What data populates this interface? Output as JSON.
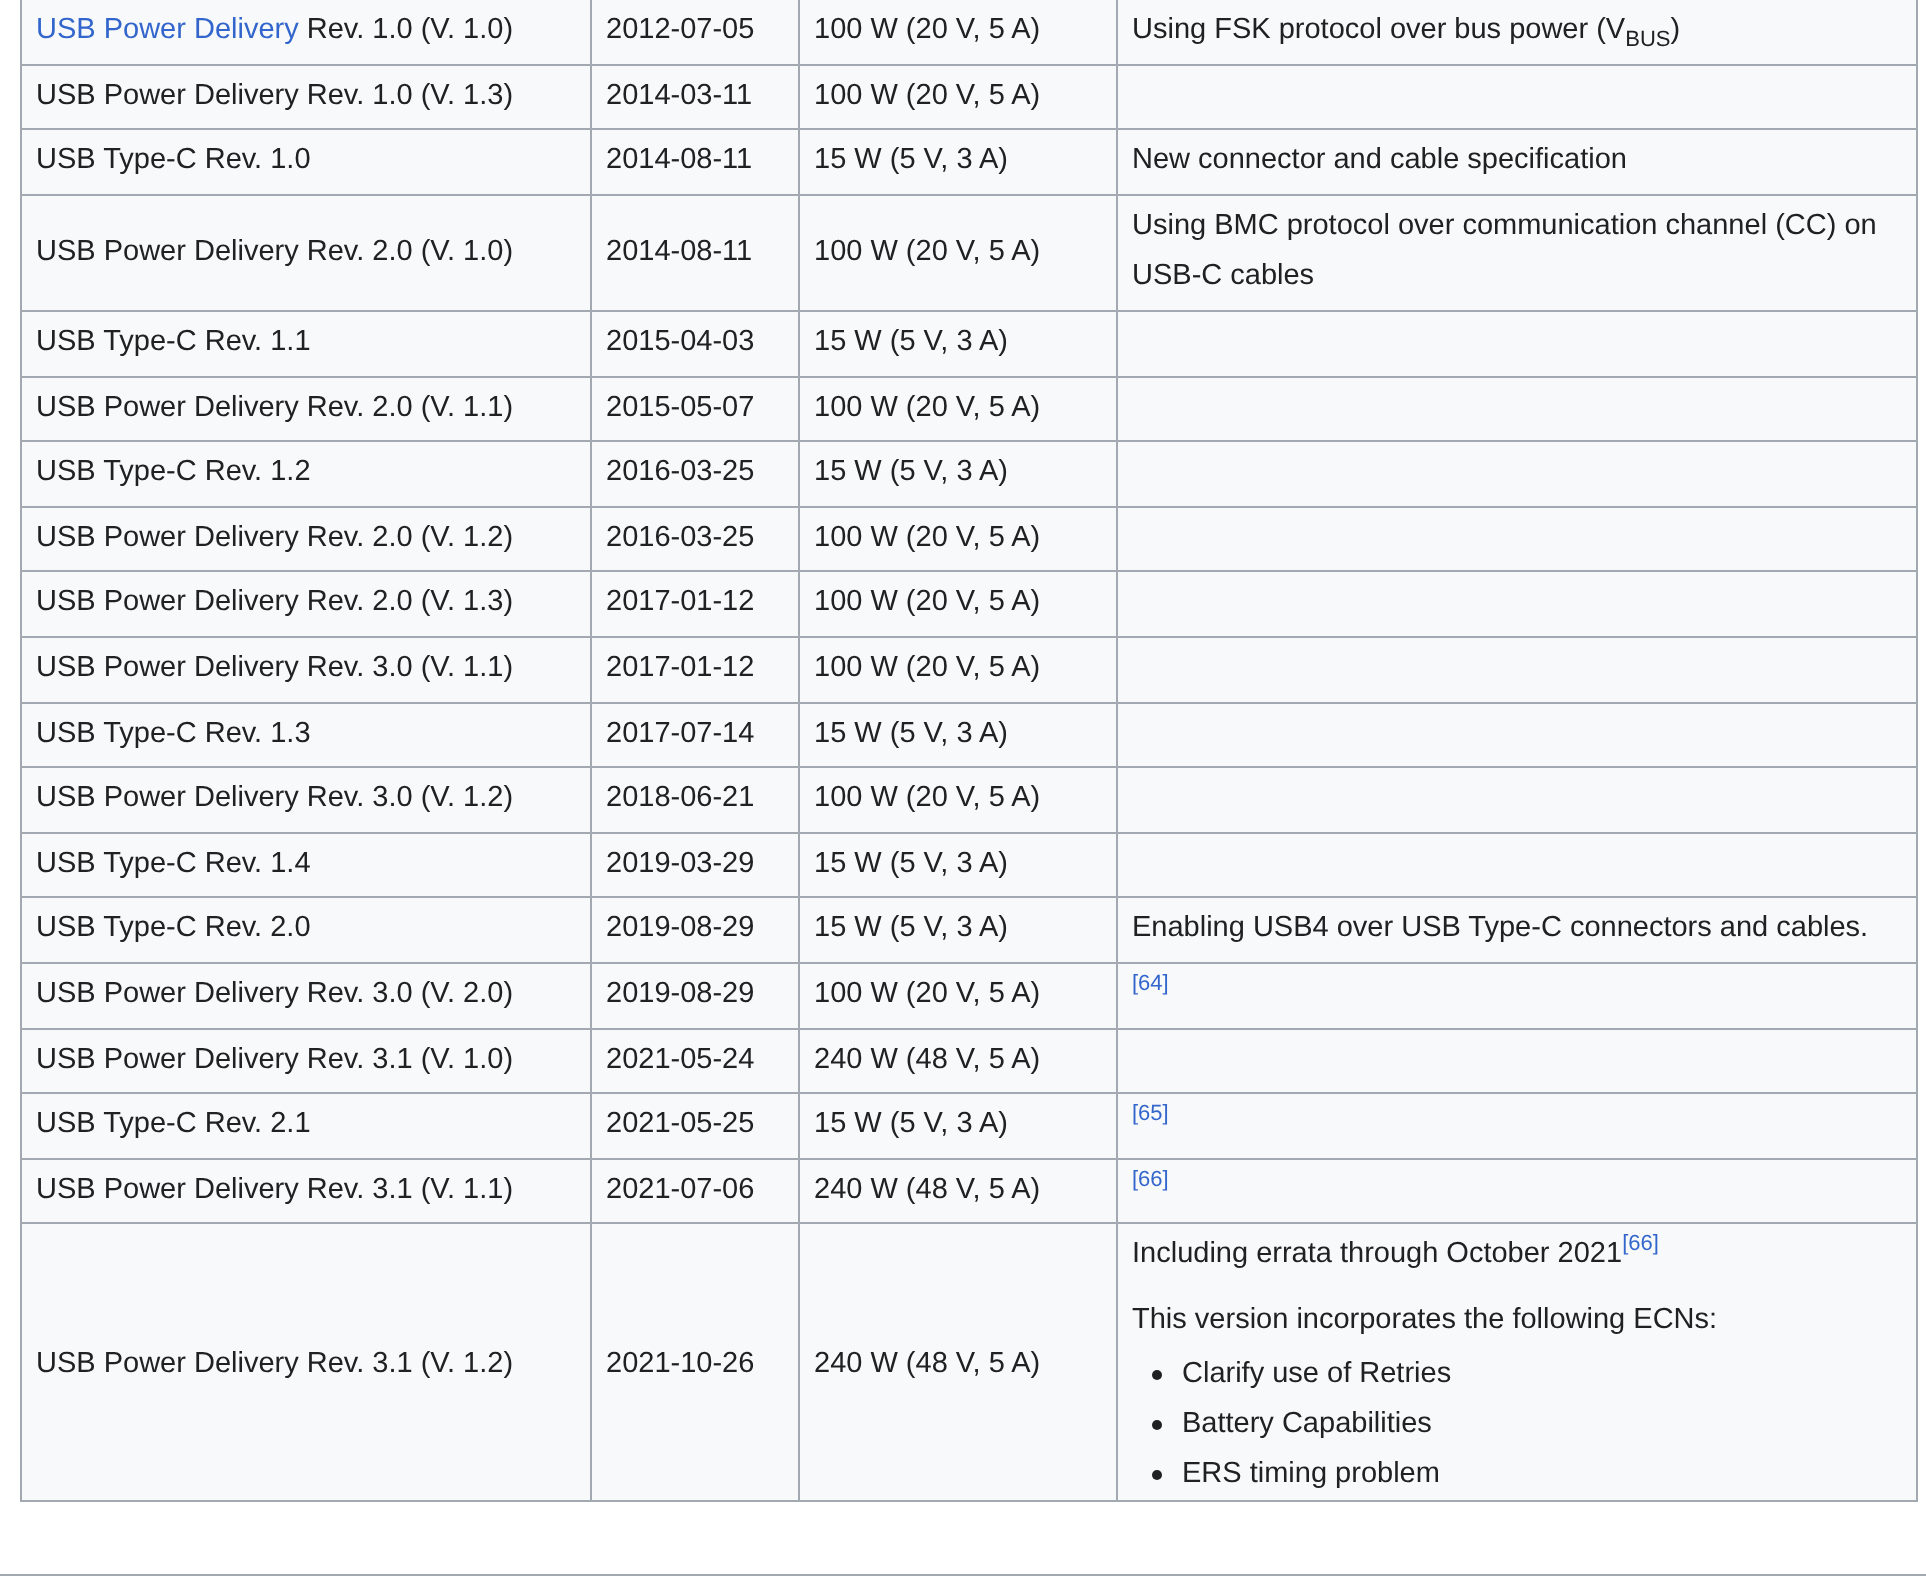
{
  "table": {
    "rows": [
      {
        "name_link": "USB Power Delivery",
        "name": " Rev. 1.0 (V. 1.0)",
        "date": "2012-07-05",
        "power": "100 W (20 V, 5 A)",
        "notes": {
          "paragraphs": [
            {
              "text": "Using FSK protocol over bus power (V$_{BUS}$)"
            }
          ]
        }
      },
      {
        "name": "USB Power Delivery Rev. 1.0 (V. 1.3)",
        "date": "2014-03-11",
        "power": "100 W (20 V, 5 A)"
      },
      {
        "name": "USB Type-C Rev. 1.0",
        "date": "2014-08-11",
        "power": "15 W (5 V, 3 A)",
        "notes": {
          "paragraphs": [
            {
              "text": "New connector and cable specification"
            }
          ]
        }
      },
      {
        "name": "USB Power Delivery Rev. 2.0 (V. 1.0)",
        "date": "2014-08-11",
        "power": "100 W (20 V, 5 A)",
        "notes": {
          "paragraphs": [
            {
              "text": "Using BMC protocol over communication channel (CC) on USB-C cables"
            }
          ]
        }
      },
      {
        "name": "USB Type-C Rev. 1.1",
        "date": "2015-04-03",
        "power": "15 W (5 V, 3 A)"
      },
      {
        "name": "USB Power Delivery Rev. 2.0 (V. 1.1)",
        "date": "2015-05-07",
        "power": "100 W (20 V, 5 A)"
      },
      {
        "name": "USB Type-C Rev. 1.2",
        "date": "2016-03-25",
        "power": "15 W (5 V, 3 A)"
      },
      {
        "name": "USB Power Delivery Rev. 2.0 (V. 1.2)",
        "date": "2016-03-25",
        "power": "100 W (20 V, 5 A)"
      },
      {
        "name": "USB Power Delivery Rev. 2.0 (V. 1.3)",
        "date": "2017-01-12",
        "power": "100 W (20 V, 5 A)"
      },
      {
        "name": "USB Power Delivery Rev. 3.0 (V. 1.1)",
        "date": "2017-01-12",
        "power": "100 W (20 V, 5 A)"
      },
      {
        "name": "USB Type-C Rev. 1.3",
        "date": "2017-07-14",
        "power": "15 W (5 V, 3 A)"
      },
      {
        "name": "USB Power Delivery Rev. 3.0 (V. 1.2)",
        "date": "2018-06-21",
        "power": "100 W (20 V, 5 A)"
      },
      {
        "name": "USB Type-C Rev. 1.4",
        "date": "2019-03-29",
        "power": "15 W (5 V, 3 A)"
      },
      {
        "name": "USB Type-C Rev. 2.0",
        "date": "2019-08-29",
        "power": "15 W (5 V, 3 A)",
        "notes": {
          "paragraphs": [
            {
              "text": "Enabling USB4 over USB Type-C connectors and cables."
            }
          ]
        }
      },
      {
        "name": "USB Power Delivery Rev. 3.0 (V. 2.0)",
        "date": "2019-08-29",
        "power": "100 W (20 V, 5 A)",
        "notes": {
          "paragraphs": [
            {
              "ref": "[64]"
            }
          ]
        }
      },
      {
        "name": "USB Power Delivery Rev. 3.1 (V. 1.0)",
        "date": "2021-05-24",
        "power": "240 W (48 V, 5 A)"
      },
      {
        "name": "USB Type-C Rev. 2.1",
        "date": "2021-05-25",
        "power": "15 W (5 V, 3 A)",
        "notes": {
          "paragraphs": [
            {
              "ref": "[65]"
            }
          ]
        }
      },
      {
        "name": "USB Power Delivery Rev. 3.1 (V. 1.1)",
        "date": "2021-07-06",
        "power": "240 W (48 V, 5 A)",
        "notes": {
          "paragraphs": [
            {
              "ref": "[66]"
            }
          ]
        }
      },
      {
        "name": "USB Power Delivery Rev. 3.1 (V. 1.2)",
        "date": "2021-10-26",
        "power": "240 W (48 V, 5 A)",
        "notes": {
          "paragraphs": [
            {
              "text": "Including errata through October 2021",
              "ref": "[66]"
            },
            {
              "text": "This version incorporates the following ECNs:"
            }
          ],
          "bullets": [
            "Clarify use of Retries",
            "Battery Capabilities",
            "ERS timing problem"
          ]
        }
      }
    ]
  }
}
